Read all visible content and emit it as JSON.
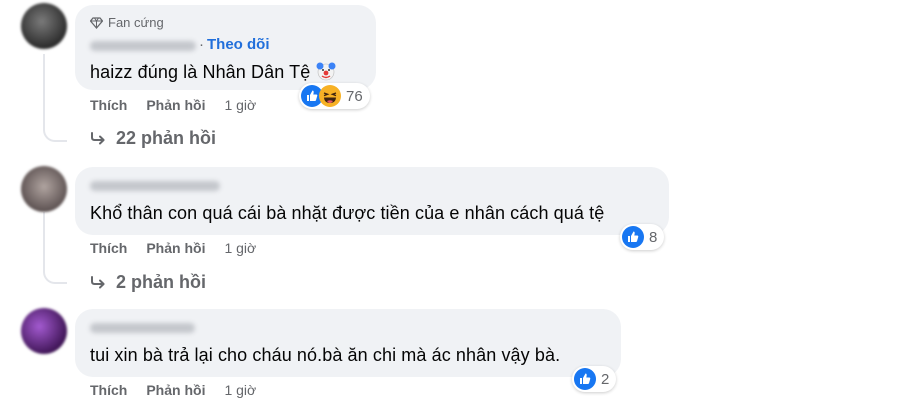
{
  "labels": {
    "like": "Thích",
    "reply": "Phản hồi"
  },
  "colors": {
    "link": "#216fdb",
    "muted": "#65676b",
    "bubble": "#f0f2f5",
    "like": "#1877f2",
    "haha": "#f7b125"
  },
  "comments": [
    {
      "badge": "Fan cứng",
      "follow": "Theo dõi",
      "text": "haizz đúng là Nhân Dân Tệ",
      "inline_emoji": "clown-face",
      "time": "1 giờ",
      "reaction_icons": [
        "like-reaction-icon",
        "haha-reaction-icon"
      ],
      "reaction_count": "76",
      "replies": "22 phản hồi"
    },
    {
      "text": "Khổ thân con quá cái bà nhặt được tiền của e nhân cách quá tệ",
      "time": "1 giờ",
      "reaction_icons": [
        "like-reaction-icon"
      ],
      "reaction_count": "8",
      "replies": "2 phản hồi"
    },
    {
      "text": "tui xin bà trả lại cho cháu nó.bà ăn chi mà ác nhân vậy bà.",
      "time": "1 giờ",
      "reaction_icons": [
        "like-reaction-icon"
      ],
      "reaction_count": "2"
    }
  ]
}
